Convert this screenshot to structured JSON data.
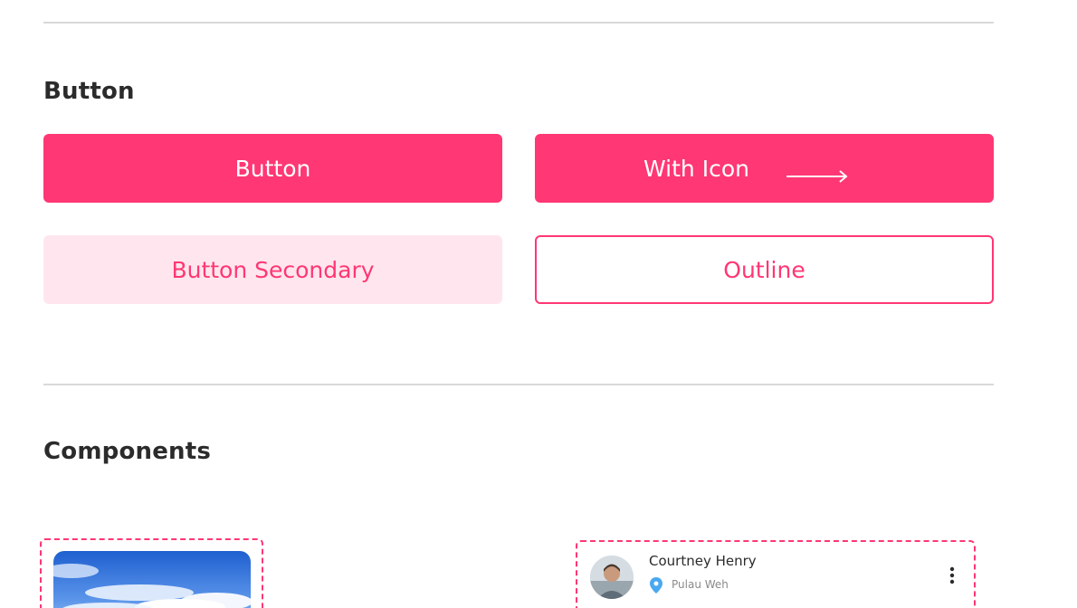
{
  "sections": {
    "button_title": "Button",
    "components_title": "Components"
  },
  "buttons": {
    "primary_label": "Button",
    "with_icon_label": "With Icon",
    "secondary_label": "Button Secondary",
    "outline_label": "Outline",
    "with_icon_icon": "arrow-right-icon"
  },
  "profile_card": {
    "name": "Courtney Henry",
    "location": "Pulau Weh",
    "location_icon": "map-pin-icon",
    "menu_icon": "more-vertical-icon"
  },
  "colors": {
    "accent": "#ff3774",
    "accent_soft": "#ffe6ee",
    "heading": "#2b2b2b",
    "divider": "#d9d9d9",
    "location_pin": "#4aa8f0"
  }
}
